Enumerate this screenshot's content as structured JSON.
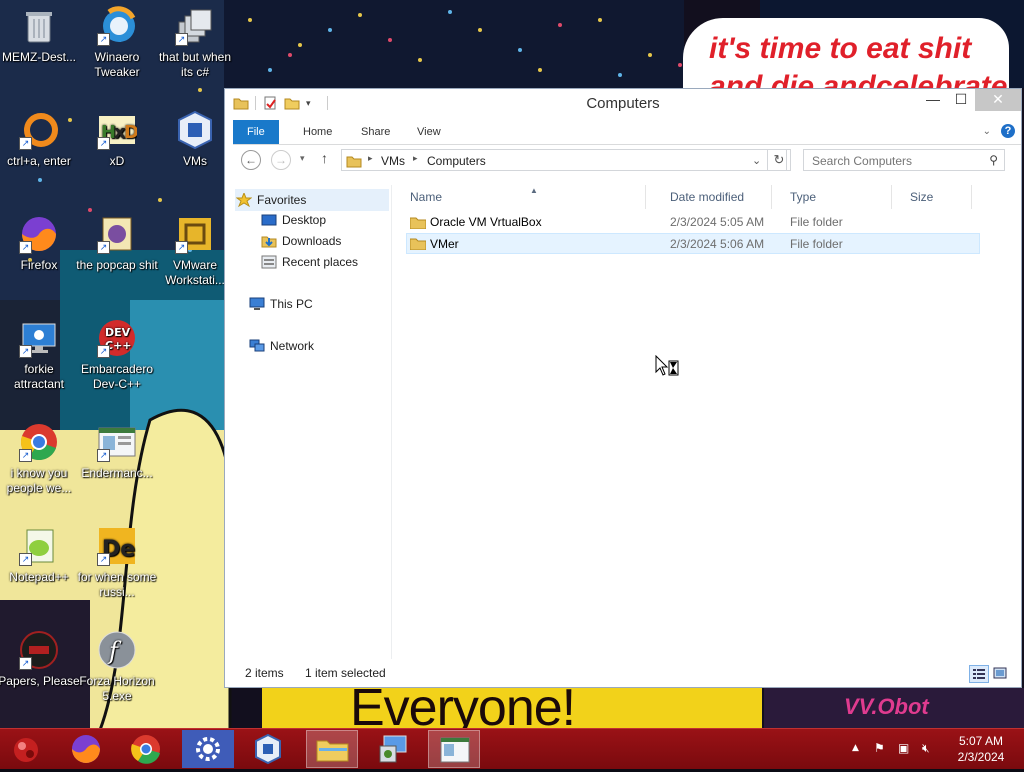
{
  "wallpaper": {
    "speech_line1": "it's time to eat shit",
    "speech_line2": "and die andcelebrate",
    "banner_text": "Everyone!",
    "right_banner_text": "VV.Obot"
  },
  "desktop_icons": [
    {
      "label": "MEMZ-Dest..."
    },
    {
      "label": "Winaero Tweaker"
    },
    {
      "label": "that but when its c#"
    },
    {
      "label": "ctrl+a, enter"
    },
    {
      "label": "xD"
    },
    {
      "label": "VMs"
    },
    {
      "label": "Firefox"
    },
    {
      "label": "the popcap shit"
    },
    {
      "label": "VMware Workstati..."
    },
    {
      "label": "forkie attractant"
    },
    {
      "label": "Embarcadero Dev-C++"
    },
    {
      "label": "i know you people we..."
    },
    {
      "label": "Endermanc..."
    },
    {
      "label": "Notepad++"
    },
    {
      "label": "for when some russi..."
    },
    {
      "label": "Papers, Please"
    },
    {
      "label": "Forza Horizon 5.exe"
    }
  ],
  "explorer": {
    "title": "Computers",
    "tabs": {
      "file": "File",
      "home": "Home",
      "share": "Share",
      "view": "View"
    },
    "address": {
      "seg1": "VMs",
      "seg2": "Computers"
    },
    "search": {
      "placeholder": "Search Computers"
    },
    "nav": {
      "favorites": "Favorites",
      "desktop": "Desktop",
      "downloads": "Downloads",
      "recent": "Recent places",
      "thispc": "This PC",
      "network": "Network"
    },
    "columns": {
      "name": "Name",
      "date": "Date modified",
      "type": "Type",
      "size": "Size"
    },
    "files": [
      {
        "name": "Oracle VM VrtualBox",
        "date": "2/3/2024 5:05 AM",
        "type": "File folder",
        "size": ""
      },
      {
        "name": "VMer",
        "date": "2/3/2024 5:06 AM",
        "type": "File folder",
        "size": ""
      }
    ],
    "status": {
      "count": "2 items",
      "selected": "1 item selected"
    }
  },
  "taskbar": {
    "time": "5:07 AM",
    "date": "2/3/2024"
  }
}
